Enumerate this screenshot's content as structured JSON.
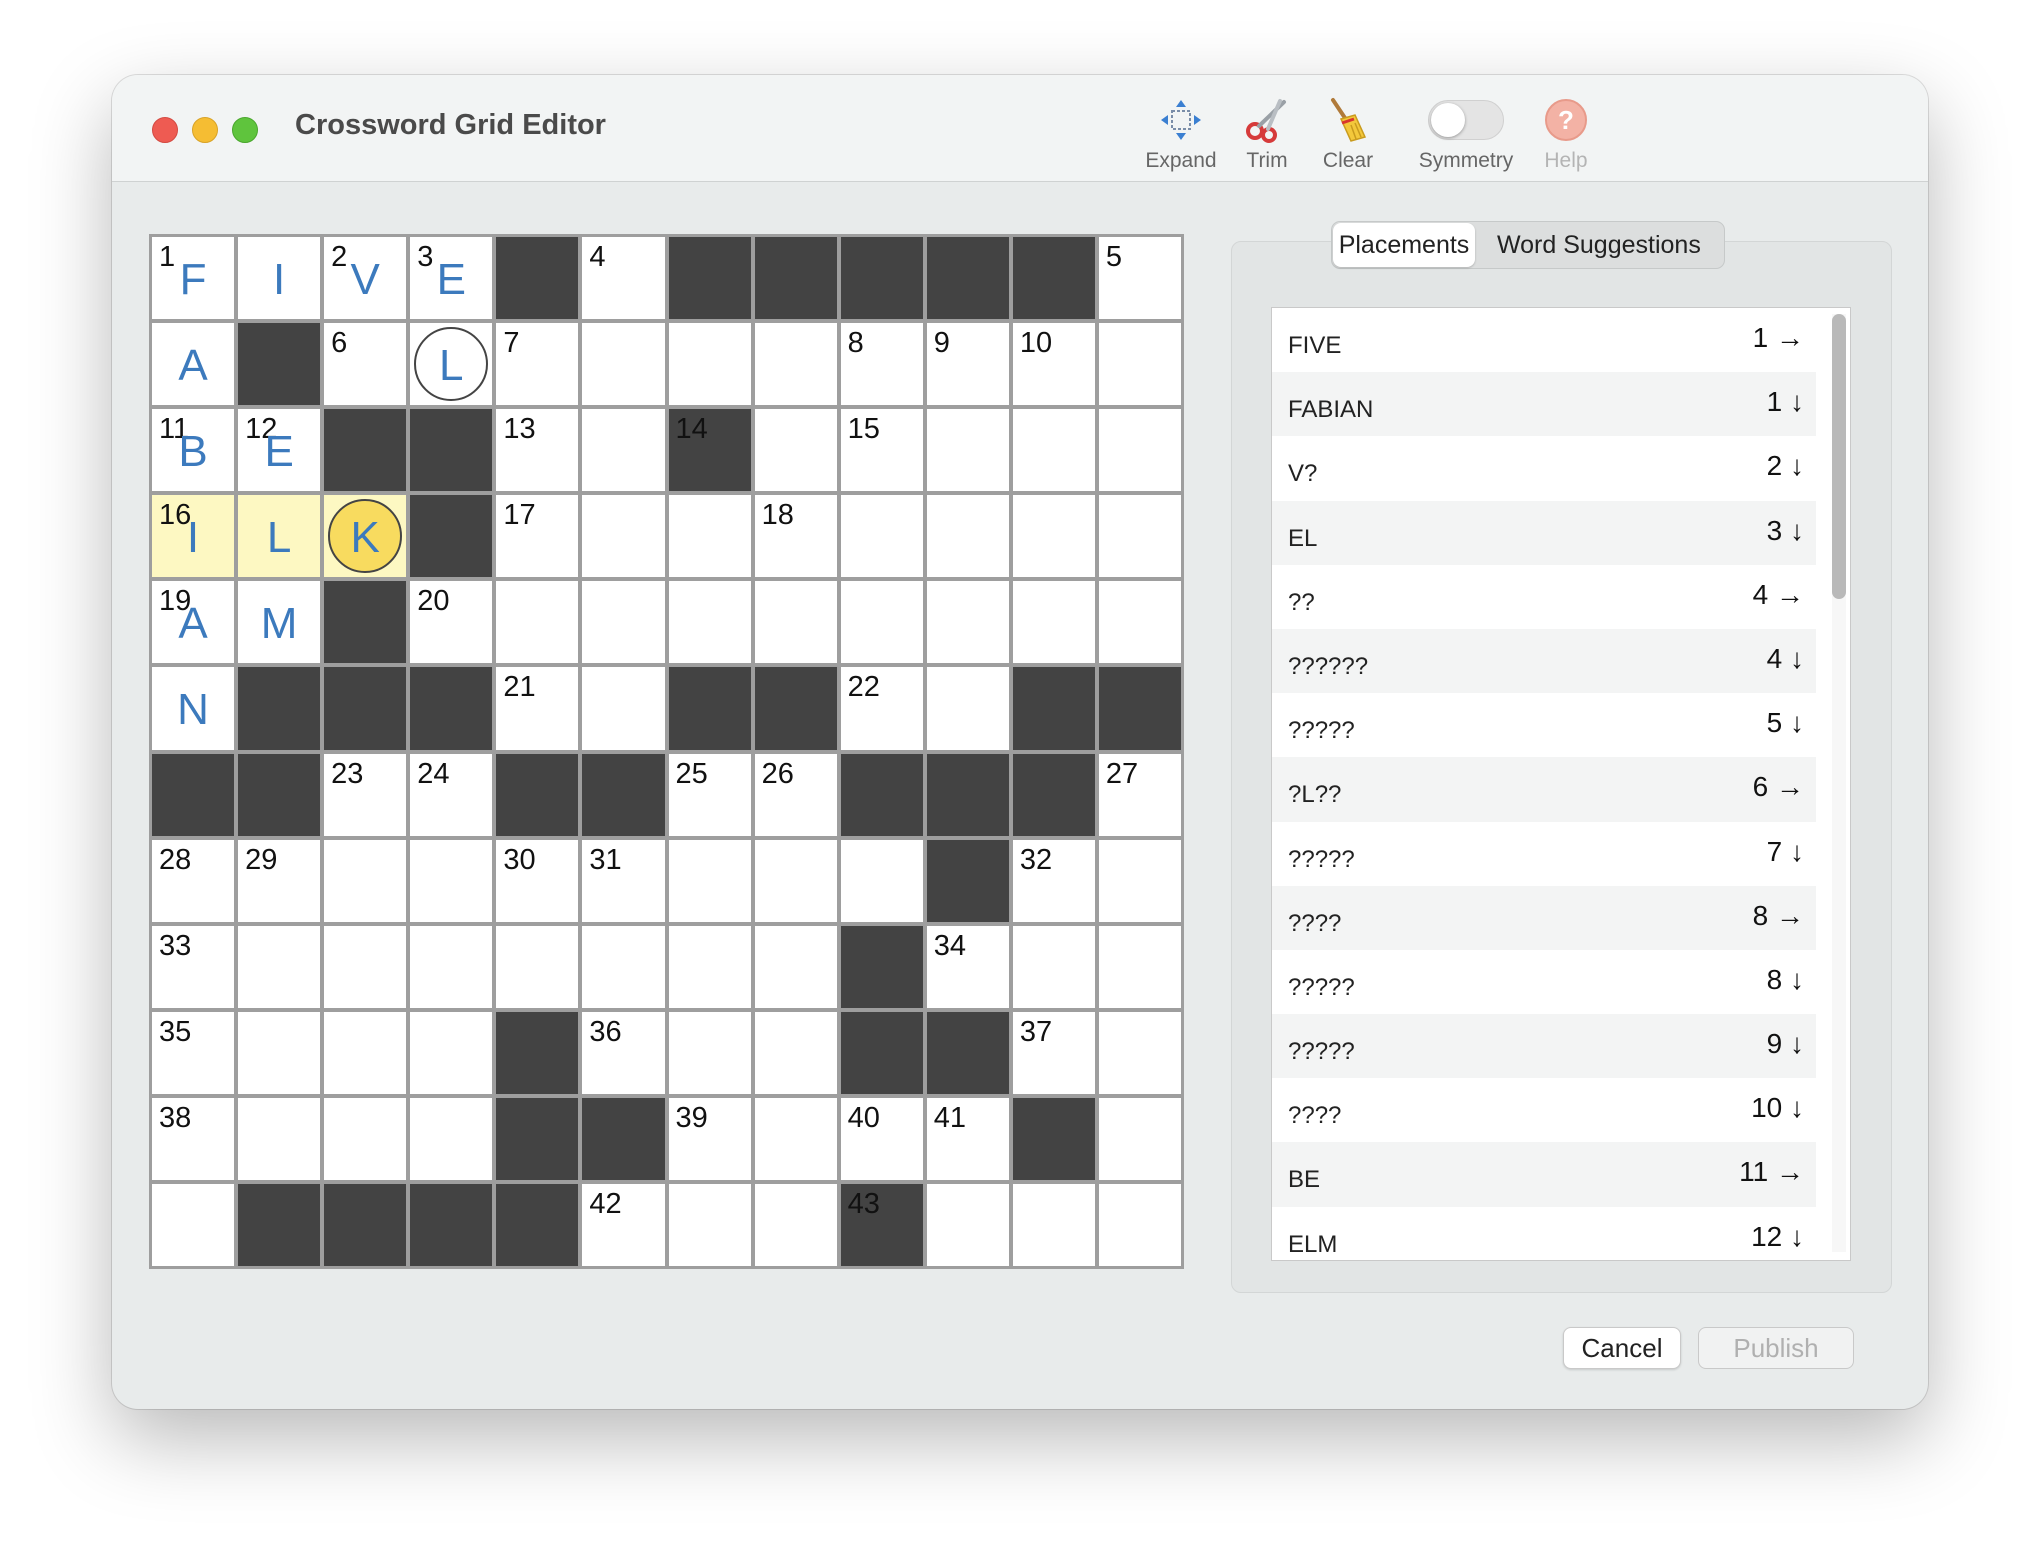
{
  "window": {
    "title": "Crossword Grid Editor"
  },
  "toolbar": {
    "expand": {
      "label": "Expand",
      "icon": "expand-arrows-icon"
    },
    "trim": {
      "label": "Trim",
      "icon": "scissors-icon"
    },
    "clear": {
      "label": "Clear",
      "icon": "broom-icon"
    },
    "symmetry": {
      "label": "Symmetry",
      "icon": "toggle-switch",
      "on": false
    },
    "help": {
      "label": "Help",
      "icon": "question-mark-icon",
      "enabled": false
    }
  },
  "colors": {
    "black_square": "#434343",
    "letter": "#3c7abd",
    "highlight": "#fdf8c2",
    "selected": "#f8db5f",
    "close": "#ee5b52",
    "minimize": "#f5bd33",
    "maximize": "#5fc43d"
  },
  "grid": {
    "size": 12,
    "rows": [
      "....#.#####.",
      ".#..........",
      "..##..#.....",
      "...#........",
      "..#.........",
      ".###..##..##",
      "##..##..###.",
      ".........#..",
      "........#...",
      "....#...##..",
      "....##....#.",
      ".####...#..."
    ],
    "numbers": [
      [
        0,
        0,
        "1"
      ],
      [
        0,
        2,
        "2"
      ],
      [
        0,
        3,
        "3"
      ],
      [
        0,
        5,
        "4"
      ],
      [
        0,
        11,
        "5"
      ],
      [
        1,
        2,
        "6"
      ],
      [
        1,
        4,
        "7"
      ],
      [
        1,
        8,
        "8"
      ],
      [
        1,
        9,
        "9"
      ],
      [
        1,
        10,
        "10"
      ],
      [
        2,
        0,
        "11"
      ],
      [
        2,
        1,
        "12"
      ],
      [
        2,
        4,
        "13"
      ],
      [
        2,
        6,
        "14"
      ],
      [
        2,
        8,
        "15"
      ],
      [
        3,
        0,
        "16"
      ],
      [
        3,
        4,
        "17"
      ],
      [
        3,
        7,
        "18"
      ],
      [
        4,
        0,
        "19"
      ],
      [
        4,
        3,
        "20"
      ],
      [
        5,
        4,
        "21"
      ],
      [
        5,
        8,
        "22"
      ],
      [
        6,
        2,
        "23"
      ],
      [
        6,
        3,
        "24"
      ],
      [
        6,
        6,
        "25"
      ],
      [
        6,
        7,
        "26"
      ],
      [
        6,
        11,
        "27"
      ],
      [
        7,
        0,
        "28"
      ],
      [
        7,
        1,
        "29"
      ],
      [
        7,
        4,
        "30"
      ],
      [
        7,
        5,
        "31"
      ],
      [
        7,
        10,
        "32"
      ],
      [
        8,
        0,
        "33"
      ],
      [
        8,
        9,
        "34"
      ],
      [
        9,
        0,
        "35"
      ],
      [
        9,
        5,
        "36"
      ],
      [
        9,
        10,
        "37"
      ],
      [
        10,
        0,
        "38"
      ],
      [
        10,
        6,
        "39"
      ],
      [
        10,
        8,
        "40"
      ],
      [
        10,
        9,
        "41"
      ],
      [
        11,
        5,
        "42"
      ],
      [
        11,
        8,
        "43"
      ]
    ],
    "letters": [
      [
        0,
        0,
        "F"
      ],
      [
        0,
        1,
        "I"
      ],
      [
        0,
        2,
        "V"
      ],
      [
        0,
        3,
        "E"
      ],
      [
        1,
        0,
        "A"
      ],
      [
        1,
        3,
        "L"
      ],
      [
        2,
        0,
        "B"
      ],
      [
        2,
        1,
        "E"
      ],
      [
        3,
        0,
        "I"
      ],
      [
        3,
        1,
        "L"
      ],
      [
        3,
        2,
        "K"
      ],
      [
        4,
        0,
        "A"
      ],
      [
        4,
        1,
        "M"
      ],
      [
        5,
        0,
        "N"
      ]
    ],
    "highlighted": [
      [
        3,
        0
      ],
      [
        3,
        1
      ],
      [
        3,
        2
      ]
    ],
    "circled": [
      [
        1,
        3
      ]
    ],
    "selected": [
      3,
      2
    ]
  },
  "tabs": [
    {
      "label": "Placements",
      "active": true
    },
    {
      "label": "Word Suggestions",
      "active": false
    }
  ],
  "placements": [
    {
      "word": "FIVE",
      "ref": "1 →"
    },
    {
      "word": "FABIAN",
      "ref": "1 ↓"
    },
    {
      "word": "V?",
      "ref": "2 ↓"
    },
    {
      "word": "EL",
      "ref": "3 ↓"
    },
    {
      "word": "??",
      "ref": "4 →"
    },
    {
      "word": "??????",
      "ref": "4 ↓"
    },
    {
      "word": "?????",
      "ref": "5 ↓"
    },
    {
      "word": "?L??",
      "ref": "6 →"
    },
    {
      "word": "?????",
      "ref": "7 ↓"
    },
    {
      "word": "????",
      "ref": "8 →"
    },
    {
      "word": "?????",
      "ref": "8 ↓"
    },
    {
      "word": "?????",
      "ref": "9 ↓"
    },
    {
      "word": "????",
      "ref": "10 ↓"
    },
    {
      "word": "BE",
      "ref": "11 →"
    },
    {
      "word": "ELM",
      "ref": "12 ↓"
    }
  ],
  "buttons": {
    "cancel": "Cancel",
    "publish": "Publish"
  }
}
